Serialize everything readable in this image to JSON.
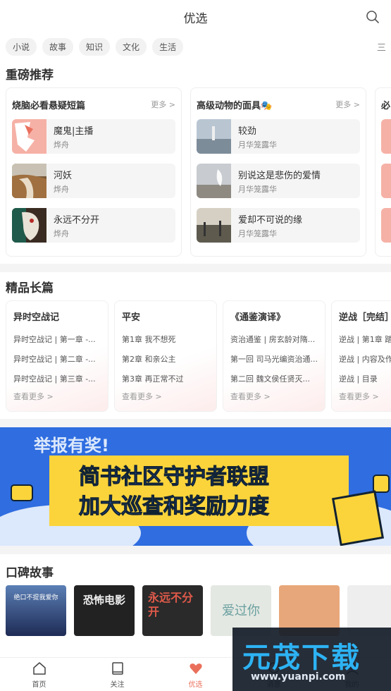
{
  "header": {
    "title": "优选"
  },
  "tags": [
    "小说",
    "故事",
    "知识",
    "文化",
    "生活"
  ],
  "tags_more": "三",
  "sections": {
    "recommend": "重磅推荐",
    "long": "精品长篇",
    "praise": "口碑故事"
  },
  "recommend_cards": [
    {
      "title": "烧脑必看悬疑短篇",
      "more": "更多 >",
      "items": [
        {
          "name": "魔鬼|主播",
          "author": "烨舟"
        },
        {
          "name": "河妖",
          "author": "烨舟"
        },
        {
          "name": "永远不分开",
          "author": "烨舟"
        }
      ]
    },
    {
      "title": "高级动物的面具🎭",
      "more": "更多 >",
      "items": [
        {
          "name": "较劲",
          "author": "月华笼露华"
        },
        {
          "name": "别说这是悲伤的爱情",
          "author": "月华笼露华"
        },
        {
          "name": "爱却不可说的缘",
          "author": "月华笼露华"
        }
      ]
    }
  ],
  "recommend_stub_title": "必",
  "long_cards": [
    {
      "title": "异时空战记",
      "chapters": [
        "异时空战记 | 第一章 -...",
        "异时空战记 | 第二章 -...",
        "异时空战记 | 第三章 -..."
      ],
      "see_more": "查看更多 >"
    },
    {
      "title": "平安",
      "chapters": [
        "第1章  我不想死",
        "第2章  和亲公主",
        "第3章  再正常不过"
      ],
      "see_more": "查看更多 >"
    },
    {
      "title": "《通鉴演译》",
      "chapters": [
        "资治通鉴 | 房玄龄对隋...",
        "第一回  司马光编资治通...",
        "第二回  魏文侯任贤灭..."
      ],
      "see_more": "查看更多 >"
    },
    {
      "title": "逆战［完结］",
      "chapters": [
        "逆战 | 第1章 踏",
        "逆战 | 内容及作",
        "逆战 | 目录"
      ],
      "see_more": "查看更多 >"
    }
  ],
  "banner": {
    "line1": "举报有奖!",
    "line2": "简书社区守护者联盟",
    "line3": "加大巡查和奖励力度"
  },
  "praise_covers": [
    {
      "text": "绝口不提我爱你"
    },
    {
      "text": "恐怖电影"
    },
    {
      "text": "永远不分开"
    },
    {
      "text": "爱过你"
    },
    {
      "text": ""
    },
    {
      "text": ""
    }
  ],
  "tabbar": [
    {
      "label": "首页",
      "icon": "home-icon"
    },
    {
      "label": "关注",
      "icon": "book-icon"
    },
    {
      "label": "优选",
      "icon": "heart-icon"
    },
    {
      "label": "消息",
      "icon": "message-icon"
    },
    {
      "label": "我的",
      "icon": "user-icon"
    }
  ],
  "watermark": {
    "big": "元茂下载",
    "url": "www.yuanpi.com"
  },
  "colors": {
    "accent": "#ea6f5a",
    "banner_bg": "#2f6de0",
    "banner_yellow": "#fbd43b"
  }
}
